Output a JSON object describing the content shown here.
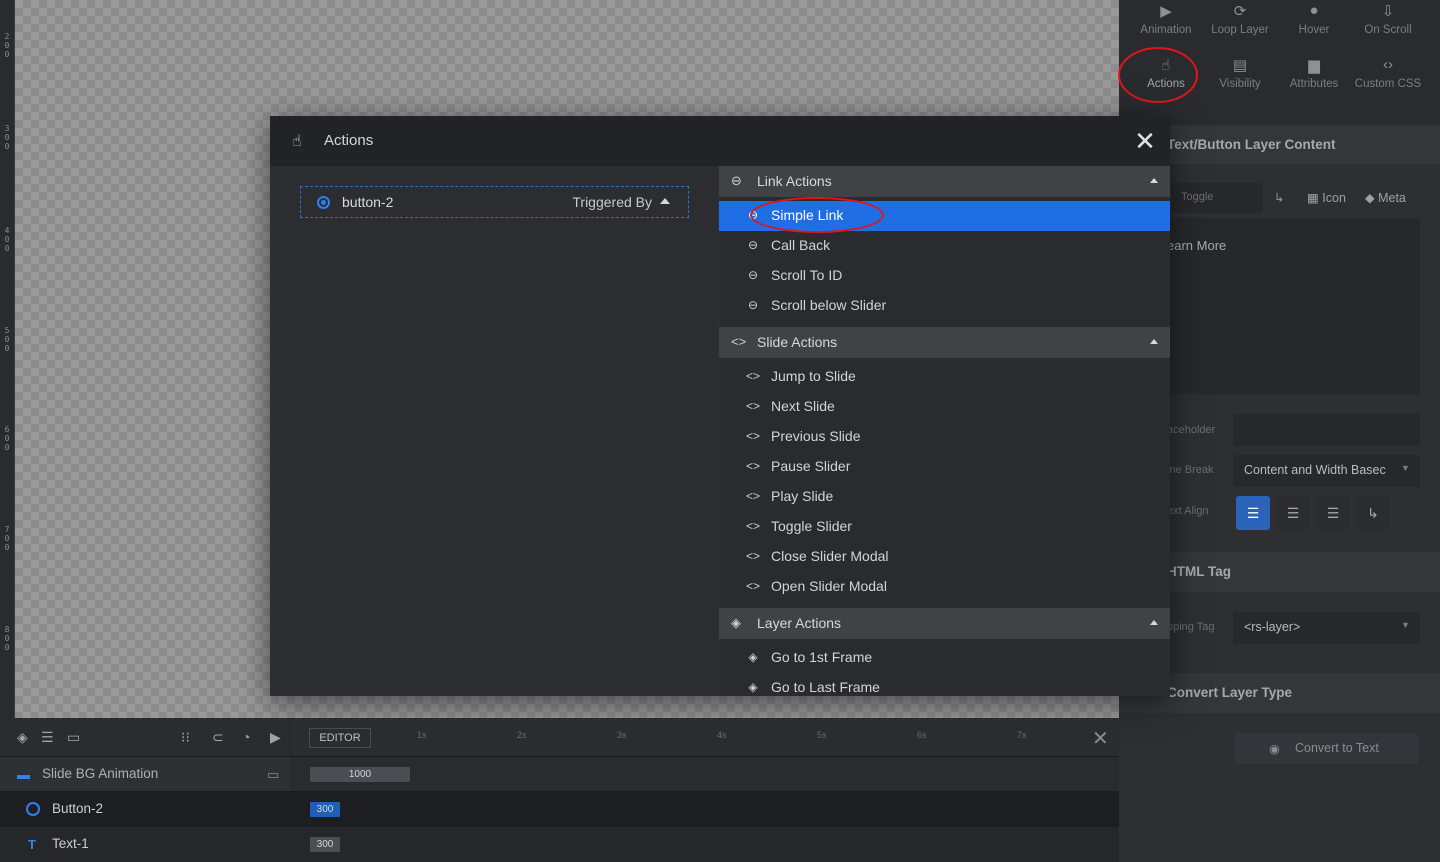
{
  "ruler": {
    "labels": [
      "2\n0\n0",
      "3\n0\n0",
      "4\n0\n0",
      "5\n0\n0",
      "6\n0\n0",
      "7\n0\n0",
      "8\n0\n0"
    ]
  },
  "right_panel": {
    "tabs": [
      {
        "label": "Animation",
        "icon": "play-icon"
      },
      {
        "label": "Loop Layer",
        "icon": "loop-icon"
      },
      {
        "label": "Hover",
        "icon": "mouse-icon"
      },
      {
        "label": "On Scroll",
        "icon": "scroll-icon"
      },
      {
        "label": "Actions",
        "icon": "pointer-hand-icon"
      },
      {
        "label": "Visibility",
        "icon": "visibility-icon"
      },
      {
        "label": "Attributes",
        "icon": "document-icon"
      },
      {
        "label": "Custom CSS",
        "icon": "code-icon"
      }
    ],
    "section_content": "Text/Button Layer Content",
    "toggle_label": "Toggle",
    "icon_label": "Icon",
    "meta_label": "Meta",
    "content_text": "earn More",
    "placeholder_label": "aceholder",
    "line_break_label": "ine Break",
    "line_break_value": "Content and Width Basec",
    "text_align_label": "ext Align",
    "section_html_tag": "HTML Tag",
    "wrapping_tag_label": "pping Tag",
    "wrapping_tag_value": "<rs-layer>",
    "section_convert": "Convert Layer Type",
    "convert_button": "Convert to Text"
  },
  "modal": {
    "title": "Actions",
    "trigger": {
      "name": "button-2",
      "triggered_by": "Triggered By"
    },
    "groups": [
      {
        "label": "Link Actions",
        "icon": "link-icon",
        "items": [
          {
            "label": "Simple Link",
            "selected": true
          },
          {
            "label": "Call Back"
          },
          {
            "label": "Scroll To ID"
          },
          {
            "label": "Scroll below Slider"
          }
        ]
      },
      {
        "label": "Slide Actions",
        "icon": "code-icon",
        "items": [
          {
            "label": "Jump to Slide"
          },
          {
            "label": "Next Slide"
          },
          {
            "label": "Previous Slide"
          },
          {
            "label": "Pause Slider"
          },
          {
            "label": "Play Slide"
          },
          {
            "label": "Toggle Slider"
          },
          {
            "label": "Close Slider Modal"
          },
          {
            "label": "Open Slider Modal"
          }
        ]
      },
      {
        "label": "Layer Actions",
        "icon": "layers-icon",
        "items": [
          {
            "label": "Go to 1st Frame"
          },
          {
            "label": "Go to Last Frame"
          }
        ]
      }
    ]
  },
  "timeline": {
    "editor_label": "EDITOR",
    "ticks": [
      "1s",
      "2s",
      "3s",
      "4s",
      "5s",
      "6s",
      "7s"
    ],
    "rows": [
      {
        "label": "Slide BG Animation",
        "bar": "1000"
      },
      {
        "label": "Button-2",
        "bar": "300"
      },
      {
        "label": "Text-1",
        "bar": "300"
      }
    ]
  },
  "colors": {
    "accent": "#1f6ee3",
    "highlight_ring": "#e0161b"
  }
}
